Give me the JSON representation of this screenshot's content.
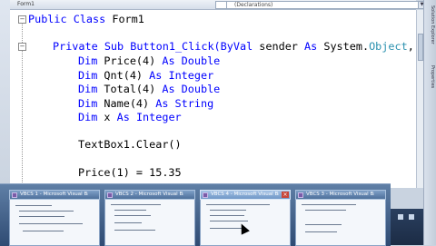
{
  "tabs": {
    "document": "Form1",
    "declarations": "(Declarations)"
  },
  "code": {
    "l1": [
      "Public Class ",
      "Form1"
    ],
    "l2": [
      "Private Sub Button1_Click(",
      "ByVal",
      " sender ",
      "As",
      " System.",
      "Object",
      ","
    ],
    "l3": [
      "Dim",
      " Price(4) ",
      "As",
      " Double"
    ],
    "l4": [
      "Dim",
      " Qnt(4) ",
      "As",
      " Integer"
    ],
    "l5": [
      "Dim",
      " Total(4) ",
      "As",
      " Double"
    ],
    "l6": [
      "Dim",
      " Name(4) ",
      "As",
      " String"
    ],
    "l7": [
      "Dim",
      " x ",
      "As",
      " Integer"
    ],
    "l8": "TextBox1.Clear()",
    "l9": "Price(1) = 15.35"
  },
  "right_panel": {
    "tab1": "Solution Explorer",
    "tab2": "Properties"
  },
  "taskbar_previews": [
    {
      "title": "VBCS 1 - Microsoft Visual Basic 2010 Express"
    },
    {
      "title": "VBCS 2 - Microsoft Visual Basic 2010 Express"
    },
    {
      "title": "VBCS 4 - Microsoft Visual Basic 2010 Express"
    },
    {
      "title": "VBCS 3 - Microsoft Visual Basic 2010 Express"
    }
  ],
  "colors": {
    "keyword": "#0000ff",
    "type": "#2b91af",
    "text": "#000000"
  }
}
